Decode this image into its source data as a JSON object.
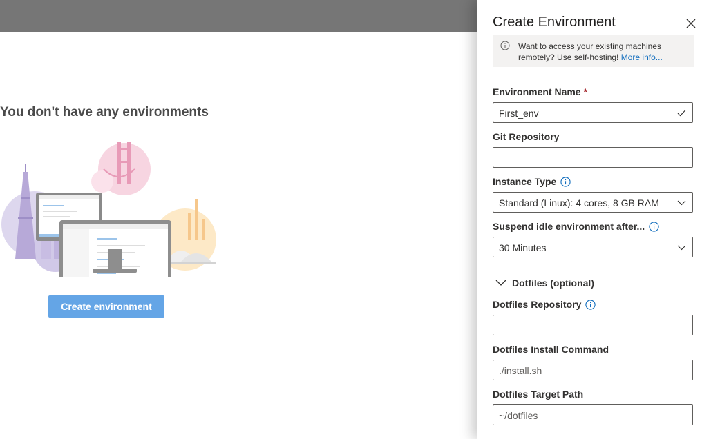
{
  "main": {
    "empty_title": "You don't have any environments",
    "create_button": "Create environment"
  },
  "panel": {
    "title": "Create Environment",
    "notice": {
      "text": "Want to access your existing machines remotely? Use self-hosting!",
      "link": "More info..."
    },
    "fields": {
      "env_name": {
        "label": "Environment Name",
        "required_mark": "*",
        "value": "First_env"
      },
      "git_repo": {
        "label": "Git Repository",
        "value": ""
      },
      "instance_type": {
        "label": "Instance Type",
        "value": "Standard (Linux): 4 cores, 8 GB RAM"
      },
      "suspend": {
        "label": "Suspend idle environment after...",
        "value": "30 Minutes"
      },
      "dotfiles_toggle": "Dotfiles (optional)",
      "dotfiles_repo": {
        "label": "Dotfiles Repository",
        "value": ""
      },
      "install_cmd": {
        "label": "Dotfiles Install Command",
        "placeholder": "./install.sh"
      },
      "target_path": {
        "label": "Dotfiles Target Path",
        "placeholder": "~/dotfiles"
      }
    }
  },
  "colors": {
    "accent": "#0f6cbd",
    "button": "#64a5e6",
    "overlay": "#767676",
    "required": "#a4262c"
  },
  "icons": [
    "close-icon",
    "info-icon",
    "checkmark-icon",
    "chevron-down-icon"
  ]
}
